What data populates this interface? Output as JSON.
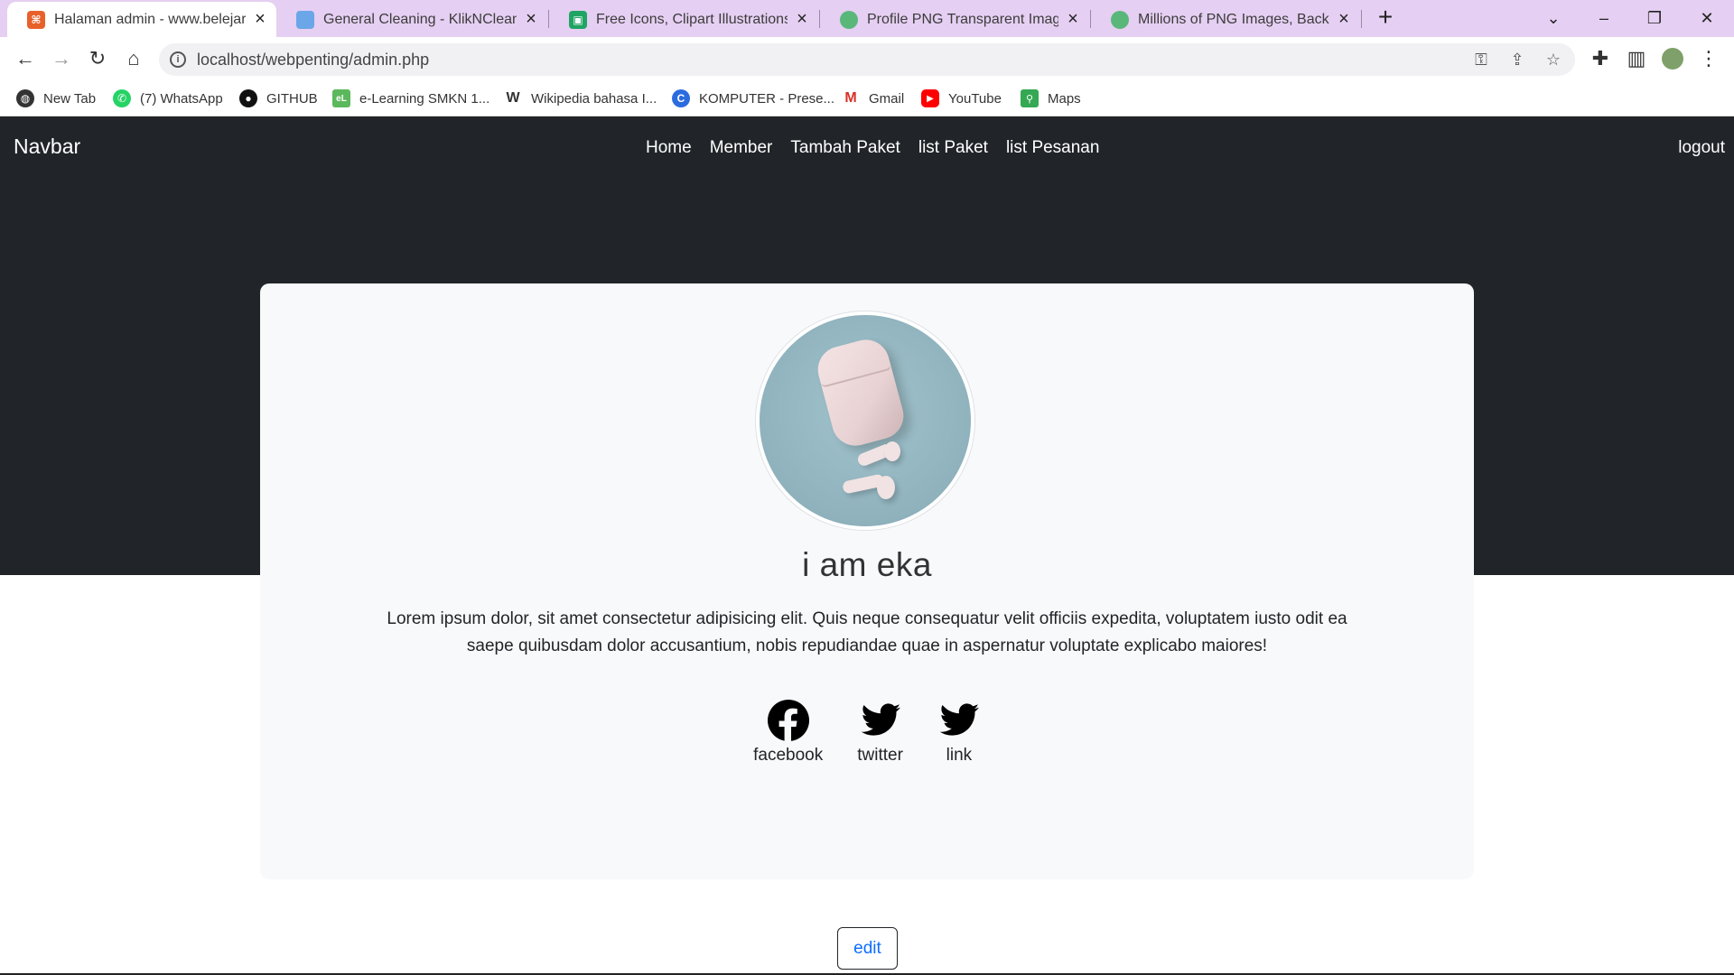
{
  "tabs": [
    {
      "title": "Halaman admin - www.belejarwit",
      "active": true,
      "favicon_color": "#e8602a"
    },
    {
      "title": "General Cleaning - KlikNClean",
      "active": false,
      "favicon_color": "#6aa6e8"
    },
    {
      "title": "Free Icons, Clipart Illustrations, Pl",
      "active": false,
      "favicon_color": "#1fa463"
    },
    {
      "title": "Profile PNG Transparent Images F",
      "active": false,
      "favicon_color": "#5ab77a"
    },
    {
      "title": "Millions of PNG Images, Backgro",
      "active": false,
      "favicon_color": "#5ab77a"
    }
  ],
  "browser": {
    "url": "localhost/webpenting/admin.php"
  },
  "bookmarks": [
    {
      "label": "New Tab",
      "icon": "globe-icon",
      "color": "#333333"
    },
    {
      "label": "(7) WhatsApp",
      "icon": "whatsapp-icon",
      "color": "#25d366"
    },
    {
      "label": "GITHUB",
      "icon": "github-icon",
      "color": "#111111"
    },
    {
      "label": "e-Learning SMKN 1...",
      "icon": "elearning-icon",
      "color": "#5cb85c"
    },
    {
      "label": "Wikipedia bahasa I...",
      "icon": "wikipedia-icon",
      "color": "#333333"
    },
    {
      "label": "KOMPUTER - Prese...",
      "icon": "canva-icon",
      "color": "#2b6be0"
    },
    {
      "label": "Gmail",
      "icon": "gmail-icon",
      "color": "#d93025"
    },
    {
      "label": "YouTube",
      "icon": "youtube-icon",
      "color": "#ff0000"
    },
    {
      "label": "Maps",
      "icon": "maps-icon",
      "color": "#34a853"
    }
  ],
  "navbar": {
    "brand": "Navbar",
    "links": [
      "Home",
      "Member",
      "Tambah Paket",
      "list Paket",
      "list Pesanan"
    ],
    "logout": "logout"
  },
  "profile": {
    "name": "i am eka",
    "bio": "Lorem ipsum dolor, sit amet consectetur adipisicing elit. Quis neque consequatur velit officiis expedita, voluptatem iusto odit ea saepe quibusdam dolor accusantium, nobis repudiandae quae in aspernatur voluptate explicabo maiores!",
    "socials": [
      {
        "label": "facebook",
        "icon": "facebook-icon"
      },
      {
        "label": "twitter",
        "icon": "twitter-icon"
      },
      {
        "label": "link",
        "icon": "twitter-icon"
      }
    ],
    "edit_label": "edit"
  },
  "colors": {
    "hero_bg": "#212529",
    "card_bg": "#f8f9fa",
    "tabbar_bg": "#e5cff2",
    "link_blue": "#0d6efd"
  }
}
